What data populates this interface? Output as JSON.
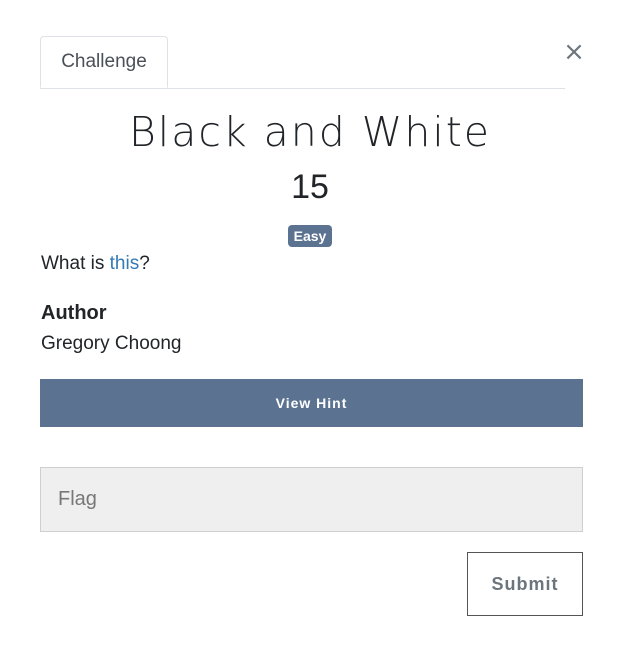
{
  "tabs": [
    {
      "label": "Challenge",
      "active": true
    }
  ],
  "close_icon": "×",
  "challenge": {
    "name": "Black and White",
    "value": "15",
    "difficulty": "Easy",
    "description_prefix": "What is ",
    "description_link": "this",
    "description_suffix": "?",
    "author_label": "Author",
    "author_name": "Gregory Choong"
  },
  "hint_button_label": "View Hint",
  "flag_input": {
    "value": "",
    "placeholder": "Flag"
  },
  "submit_label": "Submit",
  "colors": {
    "accent": "#5b7290",
    "link": "#337ab7",
    "input_bg": "#efefef"
  }
}
